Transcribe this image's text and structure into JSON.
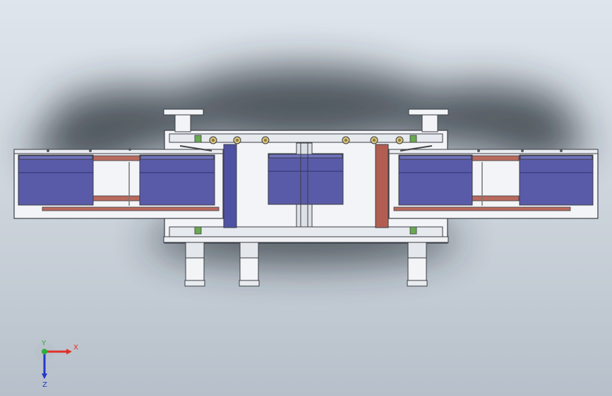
{
  "view": {
    "title": "",
    "background_top": "#dfe5ec",
    "background_bottom": "#b7c0ca"
  },
  "model": {
    "frame_color": "#f2f4f7",
    "edge_color": "#3a3d45",
    "block_color": "#5a5ba8",
    "block_light": "#7073c0",
    "belt_color": "#b86a5e",
    "roller_blue": "#4f52a2",
    "roller_red": "#b25d52",
    "fitting_color": "#d9c27a",
    "bracket_color": "#6aa84f"
  },
  "triad": {
    "x_label": "X",
    "y_label": "Y",
    "z_label": "Z",
    "x_color": "#e0312b",
    "y_color": "#2fae3b",
    "z_color": "#2437c9"
  }
}
